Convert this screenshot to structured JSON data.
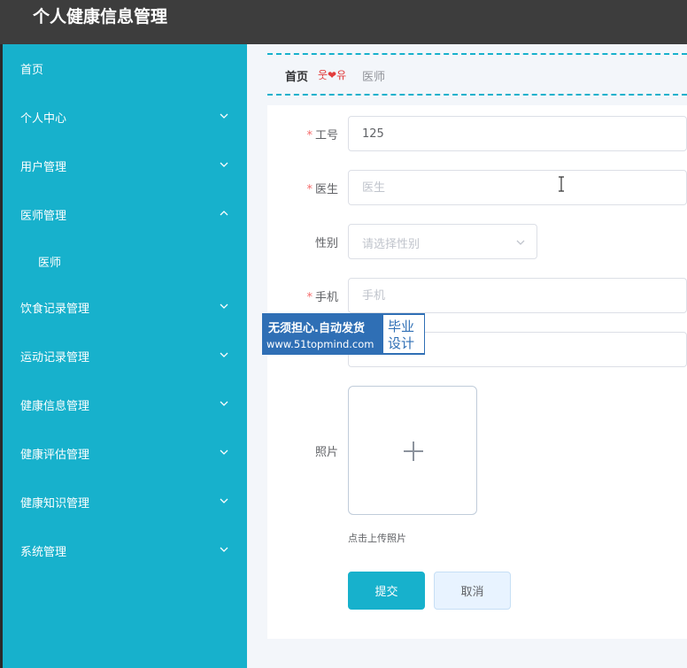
{
  "header": {
    "title": "个人健康信息管理"
  },
  "sidebar": {
    "items": [
      {
        "label": "首页",
        "expandable": false
      },
      {
        "label": "个人中心",
        "expandable": true,
        "expanded": false
      },
      {
        "label": "用户管理",
        "expandable": true,
        "expanded": false
      },
      {
        "label": "医师管理",
        "expandable": true,
        "expanded": true
      },
      {
        "label": "医师",
        "sub": true
      },
      {
        "label": "饮食记录管理",
        "expandable": true,
        "expanded": false
      },
      {
        "label": "运动记录管理",
        "expandable": true,
        "expanded": false
      },
      {
        "label": "健康信息管理",
        "expandable": true,
        "expanded": false
      },
      {
        "label": "健康评估管理",
        "expandable": true,
        "expanded": false
      },
      {
        "label": "健康知识管理",
        "expandable": true,
        "expanded": false
      },
      {
        "label": "系统管理",
        "expandable": true,
        "expanded": false
      }
    ]
  },
  "breadcrumb": {
    "home": "首页",
    "separator": "웃❤유",
    "current": "医师"
  },
  "form": {
    "required_mark": "*",
    "job_no": {
      "label": "工号",
      "value": "125"
    },
    "doctor": {
      "label": "医生",
      "placeholder": "医生"
    },
    "gender": {
      "label": "性别",
      "placeholder": "请选择性别"
    },
    "phone": {
      "label": "手机",
      "placeholder": "手机"
    },
    "photo": {
      "label": "照片",
      "tip": "点击上传照片"
    },
    "submit_label": "提交",
    "cancel_label": "取消"
  },
  "watermark": {
    "line1": "无须担心.自动发货",
    "line2": "www.51topmind.com",
    "box_line1": "毕业",
    "box_line2": "设计"
  },
  "colors": {
    "accent": "#17b1cc",
    "topbar": "#3d3d3d",
    "required": "#f56c6c"
  }
}
